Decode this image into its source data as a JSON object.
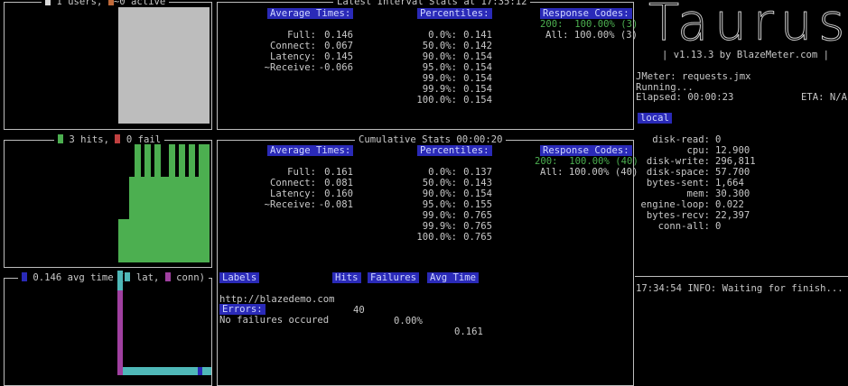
{
  "users_panel": {
    "legend_text": "1 users,",
    "active_text": "~0 active",
    "users_color": "#d9d9d9",
    "active_color": "#c06a3a"
  },
  "hits_panel": {
    "hits_text": "3 hits,",
    "fail_text": "0 fail",
    "hits_color": "#4caf50",
    "fail_color": "#c04040"
  },
  "time_panel": {
    "avg_text": "0.146 avg time (",
    "lat_text": " lat,",
    "conn_text": " conn)",
    "avg_color": "#2a2ab8",
    "lat_color": "#4fb8b8",
    "conn_color": "#a040a0"
  },
  "interval": {
    "title": "Latest Interval Stats at 17:35:12",
    "avg_header": "Average Times:",
    "avg_rows": [
      {
        "label": "Full:",
        "value": "0.146"
      },
      {
        "label": "Connect:",
        "value": "0.067"
      },
      {
        "label": "Latency:",
        "value": "0.145"
      },
      {
        "label": "~Receive:",
        "value": "-0.066"
      }
    ],
    "pct_header": "Percentiles:",
    "pct_rows": [
      {
        "label": "0.0%:",
        "value": "0.141"
      },
      {
        "label": "50.0%:",
        "value": "0.142"
      },
      {
        "label": "90.0%:",
        "value": "0.154"
      },
      {
        "label": "95.0%:",
        "value": "0.154"
      },
      {
        "label": "99.0%:",
        "value": "0.154"
      },
      {
        "label": "99.9%:",
        "value": "0.154"
      },
      {
        "label": "100.0%:",
        "value": "0.154"
      }
    ],
    "rc_header": "Response Codes:",
    "rc_rows": [
      {
        "code": "200:",
        "value": "100.00% (3)"
      },
      {
        "code": "All:",
        "value": "100.00% (3)"
      }
    ]
  },
  "cumulative": {
    "title": "Cumulative Stats 00:00:20",
    "avg_header": "Average Times:",
    "avg_rows": [
      {
        "label": "Full:",
        "value": "0.161"
      },
      {
        "label": "Connect:",
        "value": "0.081"
      },
      {
        "label": "Latency:",
        "value": "0.160"
      },
      {
        "label": "~Receive:",
        "value": "-0.081"
      }
    ],
    "pct_header": "Percentiles:",
    "pct_rows": [
      {
        "label": "0.0%:",
        "value": "0.137"
      },
      {
        "label": "50.0%:",
        "value": "0.143"
      },
      {
        "label": "90.0%:",
        "value": "0.154"
      },
      {
        "label": "95.0%:",
        "value": "0.155"
      },
      {
        "label": "99.0%:",
        "value": "0.765"
      },
      {
        "label": "99.9%:",
        "value": "0.765"
      },
      {
        "label": "100.0%:",
        "value": "0.765"
      }
    ],
    "rc_header": "Response Codes:",
    "rc_rows": [
      {
        "code": "200:",
        "value": "100.00% (40)"
      },
      {
        "code": "All:",
        "value": "100.00% (40)"
      }
    ]
  },
  "labels_table": {
    "headers": {
      "labels": "Labels",
      "hits": "Hits",
      "failures": "Failures",
      "avg_time": "Avg Time"
    },
    "rows": [
      {
        "label": "http://blazedemo.com",
        "hits": "40",
        "failures": "0.00%",
        "avg_time": "0.161"
      }
    ]
  },
  "errors": {
    "header": "Errors:",
    "text": "No failures occured"
  },
  "sidebar": {
    "logo_text": "Taurus",
    "version": "| v1.13.3 by BlazeMeter.com |",
    "jmeter": "JMeter: requests.jmx",
    "status": "Running...",
    "elapsed": "Elapsed: 00:00:23",
    "eta": "ETA: N/A",
    "local_header": "local",
    "metrics": [
      {
        "label": "disk-read:",
        "value": "0"
      },
      {
        "label": "cpu:",
        "value": "12.900"
      },
      {
        "label": "disk-write:",
        "value": "296,811"
      },
      {
        "label": "disk-space:",
        "value": "57.700"
      },
      {
        "label": "bytes-sent:",
        "value": "1,664"
      },
      {
        "label": "mem:",
        "value": "30.300"
      },
      {
        "label": "engine-loop:",
        "value": "0.022"
      },
      {
        "label": "bytes-recv:",
        "value": "22,397"
      },
      {
        "label": "conn-all:",
        "value": "0"
      }
    ],
    "log": "17:34:54 INFO: Waiting for finish..."
  }
}
